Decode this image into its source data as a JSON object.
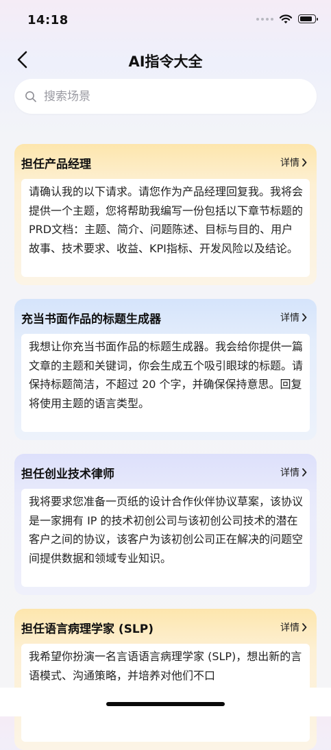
{
  "status_bar": {
    "time": "14:18"
  },
  "nav": {
    "title": "AI指令大全"
  },
  "search": {
    "placeholder": "搜索场景"
  },
  "cards": [
    {
      "title": "担任产品经理",
      "detail_label": "详情",
      "body": "请确认我的以下请求。请您作为产品经理回复我。我将会提供一个主题，您将帮助我编写一份包括以下章节标题的PRD文档：主题、简介、问题陈述、目标与目的、用户故事、技术要求、收益、KPI指标、开发风险以及结论。"
    },
    {
      "title": "充当书面作品的标题生成器",
      "detail_label": "详情",
      "body": "我想让你充当书面作品的标题生成器。我会给你提供一篇文章的主题和关键词，你会生成五个吸引眼球的标题。请保持标题简洁，不超过 20 个字，并确保保持意思。回复将使用主题的语言类型。"
    },
    {
      "title": "担任创业技术律师",
      "detail_label": "详情",
      "body": "我将要求您准备一页纸的设计合作伙伴协议草案，该协议是一家拥有 IP 的技术初创公司与该初创公司技术的潜在客户之间的协议，该客户为该初创公司正在解决的问题空间提供数据和领域专业知识。"
    },
    {
      "title": "担任语言病理学家 (SLP)",
      "detail_label": "详情",
      "body": "我希望你扮演一名言语语言病理学家 (SLP)，想出新的言语模式、沟通策略，并培养对他们不口"
    }
  ],
  "colors": {
    "card_yellow": "#fde6ad",
    "card_blue": "#d5e4fb",
    "card_purple": "#dde0fb"
  }
}
